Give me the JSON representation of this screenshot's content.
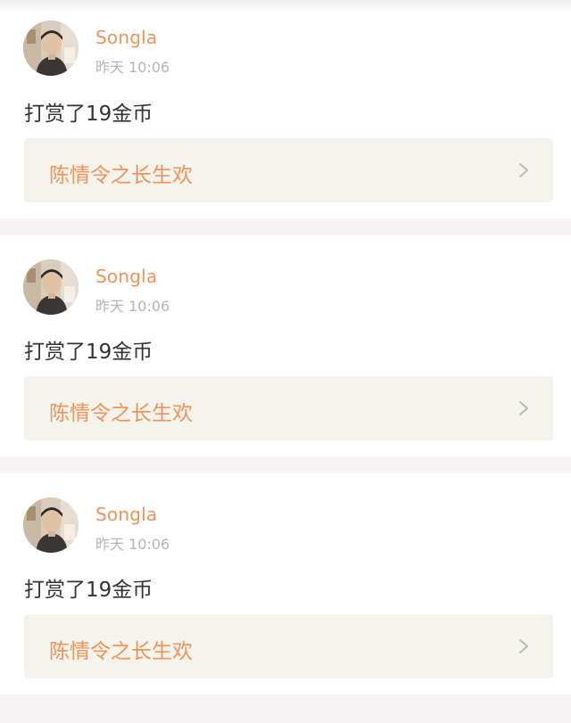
{
  "feed": {
    "items": [
      {
        "username": "Songla",
        "timestamp": "昨天 10:06",
        "message": "打赏了19金币",
        "book_title": "陈情令之长生欢",
        "avatar_icon": "user-avatar"
      },
      {
        "username": "Songla",
        "timestamp": "昨天 10:06",
        "message": "打赏了19金币",
        "book_title": "陈情令之长生欢",
        "avatar_icon": "user-avatar"
      },
      {
        "username": "Songla",
        "timestamp": "昨天 10:06",
        "message": "打赏了19金币",
        "book_title": "陈情令之长生欢",
        "avatar_icon": "user-avatar"
      }
    ]
  },
  "colors": {
    "accent": "#f0935a",
    "muted": "#b4b4b4",
    "text": "#333333",
    "link_bg": "#f4f3ec",
    "page_bg": "#f6f4f4"
  }
}
